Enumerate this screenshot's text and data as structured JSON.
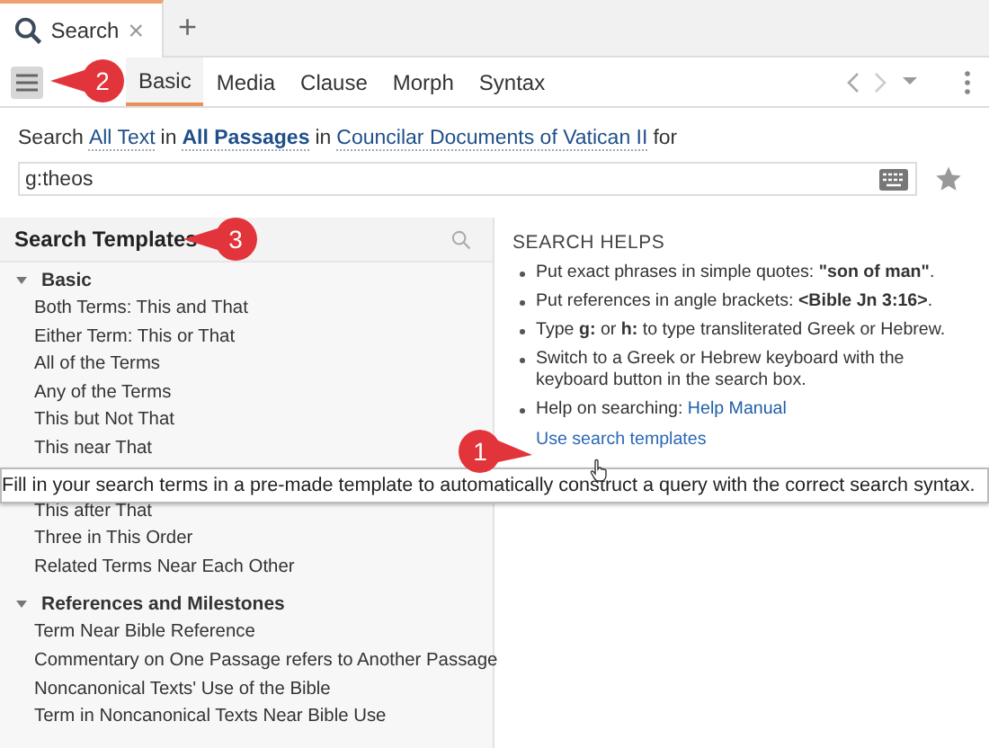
{
  "doc_tabs": [
    {
      "label": "Search",
      "close": "×",
      "selected": true
    }
  ],
  "new_tab": "+",
  "mode_tabs": [
    {
      "label": "Basic",
      "selected": true
    },
    {
      "label": "Media",
      "selected": false
    },
    {
      "label": "Clause",
      "selected": false
    },
    {
      "label": "Morph",
      "selected": false
    },
    {
      "label": "Syntax",
      "selected": false
    }
  ],
  "search_line": [
    {
      "kind": "text",
      "text": "Search"
    },
    {
      "kind": "link",
      "text": "All Text",
      "bold": false
    },
    {
      "kind": "text",
      "text": "in"
    },
    {
      "kind": "link",
      "text": "All Passages",
      "bold": true
    },
    {
      "kind": "text",
      "text": "in"
    },
    {
      "kind": "link",
      "text": "Councilar Documents of Vatican II",
      "bold": false
    },
    {
      "kind": "text",
      "text": "for"
    }
  ],
  "query": {
    "value": "g:theos"
  },
  "templates": {
    "title": "Search Templates",
    "groups": [
      {
        "label": "Basic",
        "expanded": true,
        "children": [
          "Both Terms: This and That",
          "Either Term: This or That",
          "All of the Terms",
          "Any of the Terms",
          "This but Not That",
          "This near That",
          "This after That",
          "Three in This Order",
          "Related Terms Near Each Other"
        ]
      },
      {
        "label": "References and Milestones",
        "expanded": true,
        "children": [
          "Term Near Bible Reference",
          "Commentary on One Passage refers to Another Passage",
          "Noncanonical Texts' Use of the Bible",
          "Term in Noncanonical Texts Near Bible Use"
        ]
      }
    ]
  },
  "helps": {
    "title": "SEARCH HELPS",
    "bullets": [
      {
        "kind": "text",
        "text": "Put exact phrases in simple quotes: **\"son of man\"**."
      },
      {
        "kind": "text",
        "text": "Put references in angle brackets: **<Bible Jn 3:16>**."
      },
      {
        "kind": "text",
        "text": "Type **g:** or **h:** to type transliterated Greek or Hebrew."
      },
      {
        "kind": "text",
        "text": "Switch to a Greek or Hebrew keyboard with the keyboard button in the search box."
      },
      {
        "kind": "link",
        "text": "Help on searching:",
        "link": "Help Manual"
      }
    ],
    "templates_link": "Use search templates"
  },
  "tooltip": "Fill in your search terms in a pre-made template to automatically construct a query with the correct search syntax.",
  "callouts": [
    "1",
    "2",
    "3"
  ]
}
